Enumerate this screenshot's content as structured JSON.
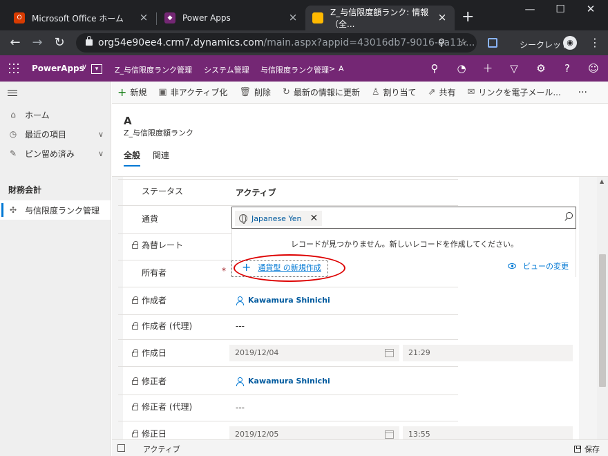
{
  "browser": {
    "tabs": [
      {
        "title": "Microsoft Office ホーム",
        "icon": "office-icon",
        "color": "#d83b01"
      },
      {
        "title": "Power Apps",
        "icon": "powerapps-icon",
        "color": "#742774"
      },
      {
        "title": "Z_与信限度額ランク: 情報（全...",
        "icon": "dynamics-icon",
        "color": "#ffb900"
      }
    ],
    "address": {
      "host": "org54e90ee4.crm7.dynamics.com",
      "path": "/main.aspx?appid=43016db7-9016-ea11-..."
    },
    "incognito_label": "シークレット"
  },
  "appbar": {
    "app_name": "PowerApps",
    "breadcrumbs": [
      "Z_与信限度ランク管理",
      "システム管理",
      "与信限度ランク管理",
      "A"
    ],
    "breadcrumb_separator": ">",
    "color": "#742774"
  },
  "sidebar": {
    "items": [
      {
        "label": "ホーム",
        "icon": "home-icon"
      },
      {
        "label": "最近の項目",
        "icon": "clock-icon"
      },
      {
        "label": "ピン留め済み",
        "icon": "pin-icon"
      }
    ],
    "group_label": "財務会計",
    "entity": {
      "label": "与信限度ランク管理",
      "icon": "puzzle-icon"
    }
  },
  "commands": [
    {
      "label": "新規",
      "icon": "plus-icon"
    },
    {
      "label": "非アクティブ化",
      "icon": "deactivate-icon"
    },
    {
      "label": "削除",
      "icon": "trash-icon"
    },
    {
      "label": "最新の情報に更新",
      "icon": "refresh-icon"
    },
    {
      "label": "割り当て",
      "icon": "assign-icon"
    },
    {
      "label": "共有",
      "icon": "share-icon"
    },
    {
      "label": "リンクを電子メール...",
      "icon": "email-icon"
    }
  ],
  "more_commands": "···",
  "record": {
    "title": "A",
    "entity": "Z_与信限度額ランク",
    "tabs": [
      "全般",
      "関連"
    ]
  },
  "fields": {
    "status": {
      "label": "ステータス",
      "value": "アクティブ"
    },
    "currency": {
      "label": "通貨",
      "value": "Japanese Yen"
    },
    "exchange_rate": {
      "label": "為替レート"
    },
    "owner": {
      "label": "所有者",
      "required_mark": "*"
    },
    "created_by": {
      "label": "作成者",
      "value": "Kawamura Shinichi"
    },
    "created_by_delegate": {
      "label": "作成者 (代理)",
      "value": "---"
    },
    "created_on": {
      "label": "作成日",
      "date": "2019/12/04",
      "time": "21:29"
    },
    "modified_by": {
      "label": "修正者",
      "value": "Kawamura Shinichi"
    },
    "modified_by_delegate": {
      "label": "修正者 (代理)",
      "value": "---"
    },
    "modified_on": {
      "label": "修正日",
      "date": "2019/12/05",
      "time": "13:55"
    }
  },
  "lookup_flyout": {
    "no_records": "レコードが見つかりません。新しいレコードを作成してください。",
    "new_record": "通貨型 の新規作成",
    "change_view": "ビューの変更"
  },
  "statusbar": {
    "status": "アクティブ",
    "save_label": "保存"
  }
}
